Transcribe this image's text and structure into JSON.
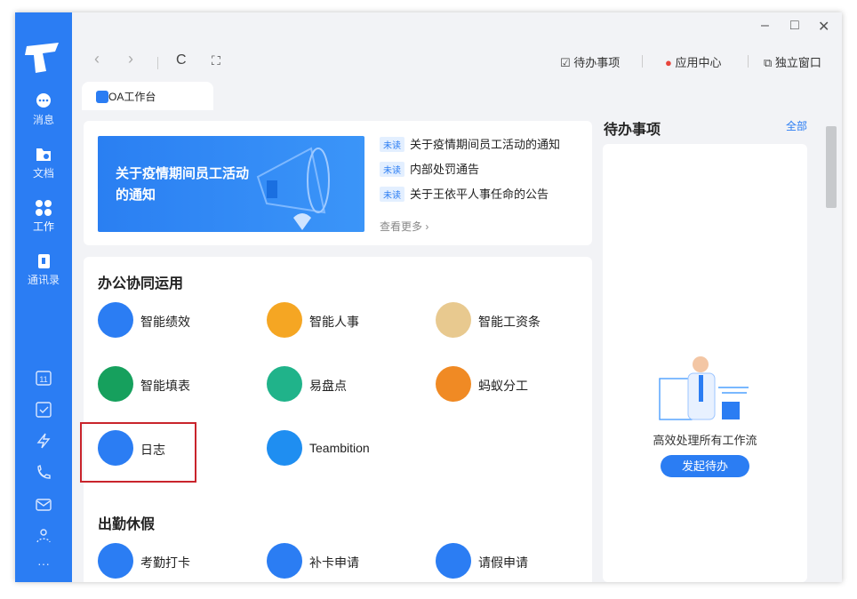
{
  "window": {
    "minimize": "–",
    "maximize": "□",
    "close": "✕"
  },
  "nav": {
    "back": "‹",
    "forward": "›",
    "refresh": "C",
    "fullscreen": "⛶"
  },
  "topbar": {
    "todo": "待办事项",
    "app_center": "应用中心",
    "standalone": "独立窗口"
  },
  "rail": {
    "items": [
      {
        "label": "消息",
        "icon": "chat-icon"
      },
      {
        "label": "文档",
        "icon": "folder-icon"
      },
      {
        "label": "工作",
        "icon": "apps-icon"
      },
      {
        "label": "通讯录",
        "icon": "contacts-icon"
      }
    ],
    "bottom_icons": [
      "calendar-icon",
      "check-icon",
      "lightning-icon",
      "phone-icon",
      "mail-icon",
      "people-icon",
      "more-icon"
    ],
    "calendar_day": "11",
    "more": "···"
  },
  "tab": {
    "label": "OA工作台"
  },
  "banner": {
    "title": "关于疫情期间员工活动的通知"
  },
  "notices": {
    "badge": "未读",
    "items": [
      "关于疫情期间员工活动的通知",
      "内部处罚通告",
      "关于王依平人事任命的公告"
    ],
    "more": "查看更多 ›"
  },
  "office": {
    "title": "办公协同运用",
    "apps": [
      {
        "label": "智能绩效",
        "color": "#2b7df3"
      },
      {
        "label": "智能人事",
        "color": "#f5a623"
      },
      {
        "label": "智能工资条",
        "color": "#e8c98f"
      },
      {
        "label": "智能填表",
        "color": "#16a05d"
      },
      {
        "label": "易盘点",
        "color": "#20b38a"
      },
      {
        "label": "蚂蚁分工",
        "color": "#f08a24"
      },
      {
        "label": "日志",
        "color": "#2b7df3"
      },
      {
        "label": "Teambition",
        "color": "#1f8ef1"
      }
    ]
  },
  "attendance": {
    "title": "出勤休假",
    "apps": [
      {
        "label": "考勤打卡",
        "color": "#2b7df3"
      },
      {
        "label": "补卡申请",
        "color": "#2b7df3"
      },
      {
        "label": "请假申请",
        "color": "#2b7df3"
      }
    ]
  },
  "todo": {
    "title": "待办事项",
    "all": "全部",
    "empty_text": "高效处理所有工作流",
    "button": "发起待办"
  }
}
